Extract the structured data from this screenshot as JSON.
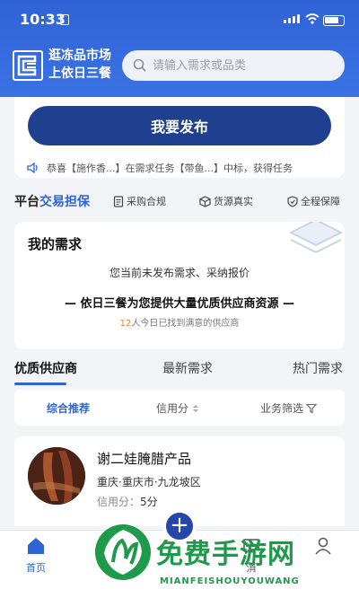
{
  "status_bar": {
    "time": "10:33"
  },
  "header": {
    "brand_line1": "逛冻品市场",
    "brand_line2": "上依日三餐",
    "search_placeholder": "请输入需求或品类"
  },
  "publish_button": "我要发布",
  "notice": {
    "text": "恭喜【施作香...】在需求任务【带鱼...】中标，获得任务"
  },
  "guarantee": {
    "title_prefix": "平台",
    "title_highlight": "交易担保",
    "items": [
      {
        "label": "采购合规",
        "icon": "document-icon"
      },
      {
        "label": "货源真实",
        "icon": "box-icon"
      },
      {
        "label": "全程保障",
        "icon": "shield-icon"
      }
    ]
  },
  "my_demand": {
    "title": "我的需求",
    "empty_text": "您当前未发布需求、采纳报价",
    "promo": "— 依日三餐为您提供大量优质供应商资源 —",
    "found_count": "12",
    "found_suffix": "人今日已找到满意的供应商"
  },
  "tabs": [
    {
      "label": "优质供应商",
      "active": true
    },
    {
      "label": "最新需求",
      "active": false
    },
    {
      "label": "热门需求",
      "active": false
    }
  ],
  "filters": [
    {
      "label": "综合推荐",
      "active": true
    },
    {
      "label": "信用分",
      "active": false
    },
    {
      "label": "业务筛选",
      "active": false
    }
  ],
  "supplier": {
    "name": "谢二娃腌腊产品",
    "location": "重庆·重庆市·九龙坡区",
    "credit_label": "信用分：",
    "credit_value": "5分"
  },
  "tabbar": {
    "items": [
      {
        "label": "首页",
        "icon": "home-icon",
        "active": true
      },
      {
        "label": "",
        "icon": "category-icon",
        "active": false
      },
      {
        "label": "消",
        "icon": "message-icon",
        "active": false
      },
      {
        "label": "",
        "icon": "profile-icon",
        "active": false
      }
    ],
    "fab": "+"
  },
  "watermark": {
    "title": "免费手游网",
    "subtitle": "MIANFEISHOUYOUWANG"
  },
  "colors": {
    "primary": "#2f63d6",
    "dark_blue": "#1f3f8f",
    "accent_orange": "#e8833a",
    "watermark_green": "#1f9a4a"
  }
}
